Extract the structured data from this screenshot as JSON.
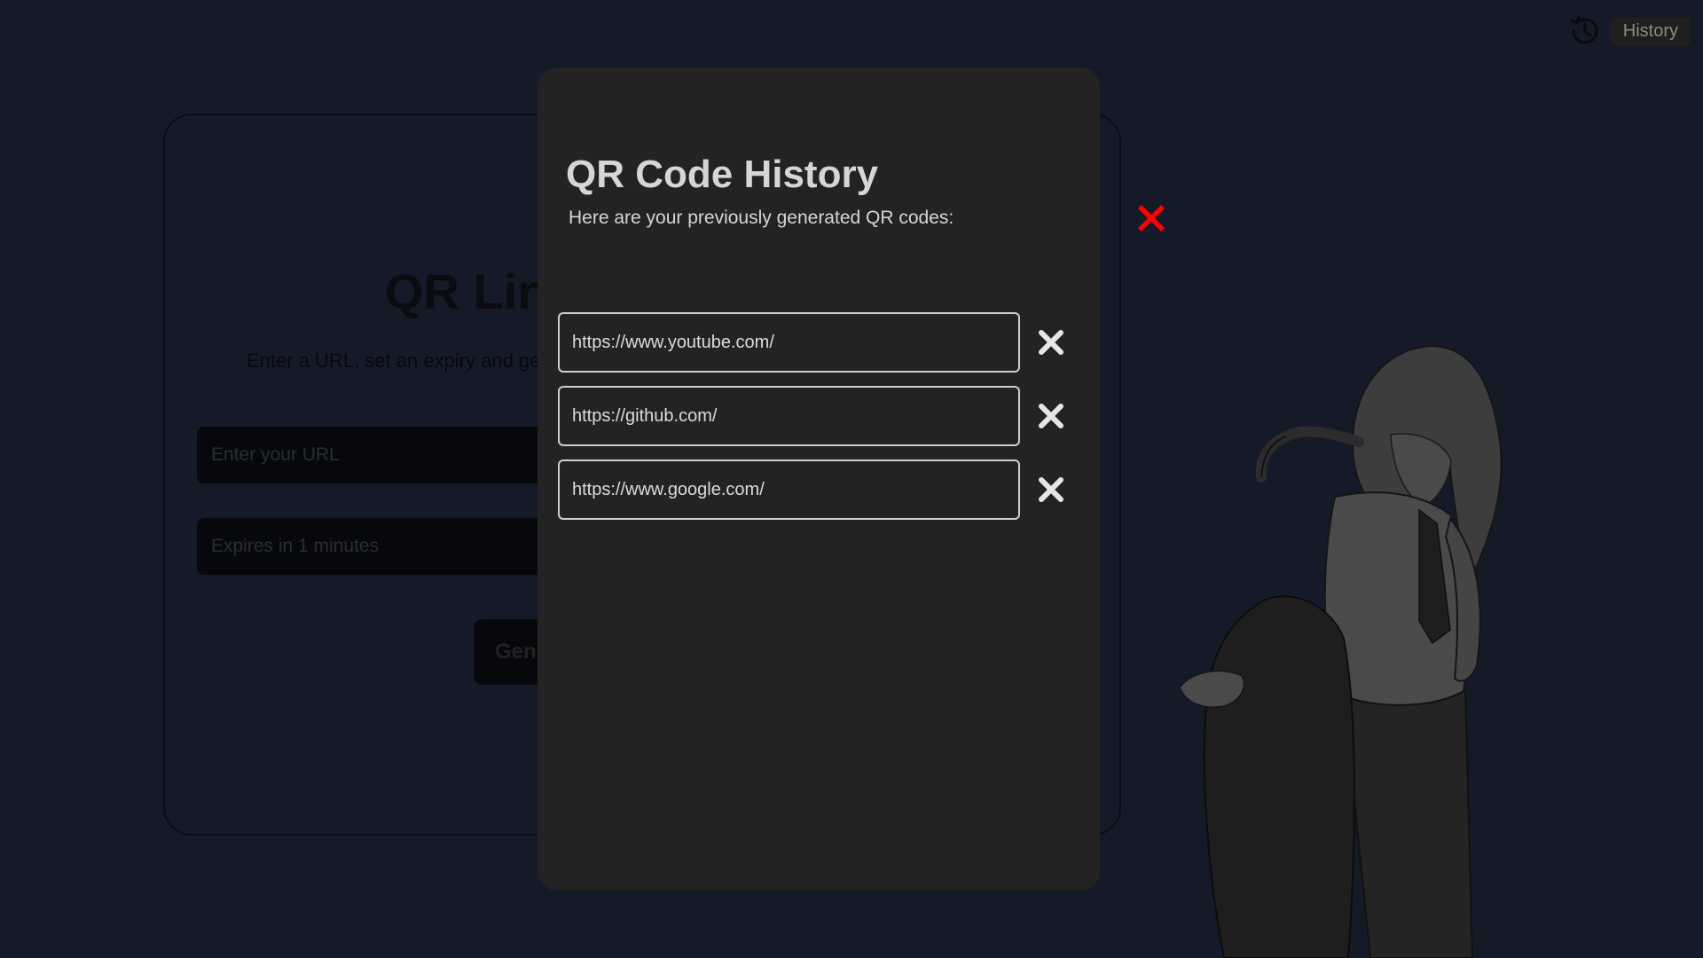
{
  "header": {
    "history_label": "History"
  },
  "main": {
    "title": "QR Lin",
    "subtitle": "Enter a URL, set an expiry and ge",
    "url_placeholder": "Enter your URL",
    "expiry_placeholder": "Expires in 1 minutes",
    "generate_label": "Gen"
  },
  "modal": {
    "title": "QR Code History",
    "subtitle": "Here are your previously generated QR codes:",
    "items": [
      {
        "url": "https://www.youtube.com/"
      },
      {
        "url": "https://github.com/"
      },
      {
        "url": "https://www.google.com/"
      }
    ]
  },
  "colors": {
    "background": "#141a28",
    "modal": "#232323",
    "close_accent": "#ff0000",
    "text": "#d6d6d6"
  },
  "icons": {
    "history": "history-clock-icon",
    "close": "close-icon",
    "remove": "remove-x-icon"
  }
}
